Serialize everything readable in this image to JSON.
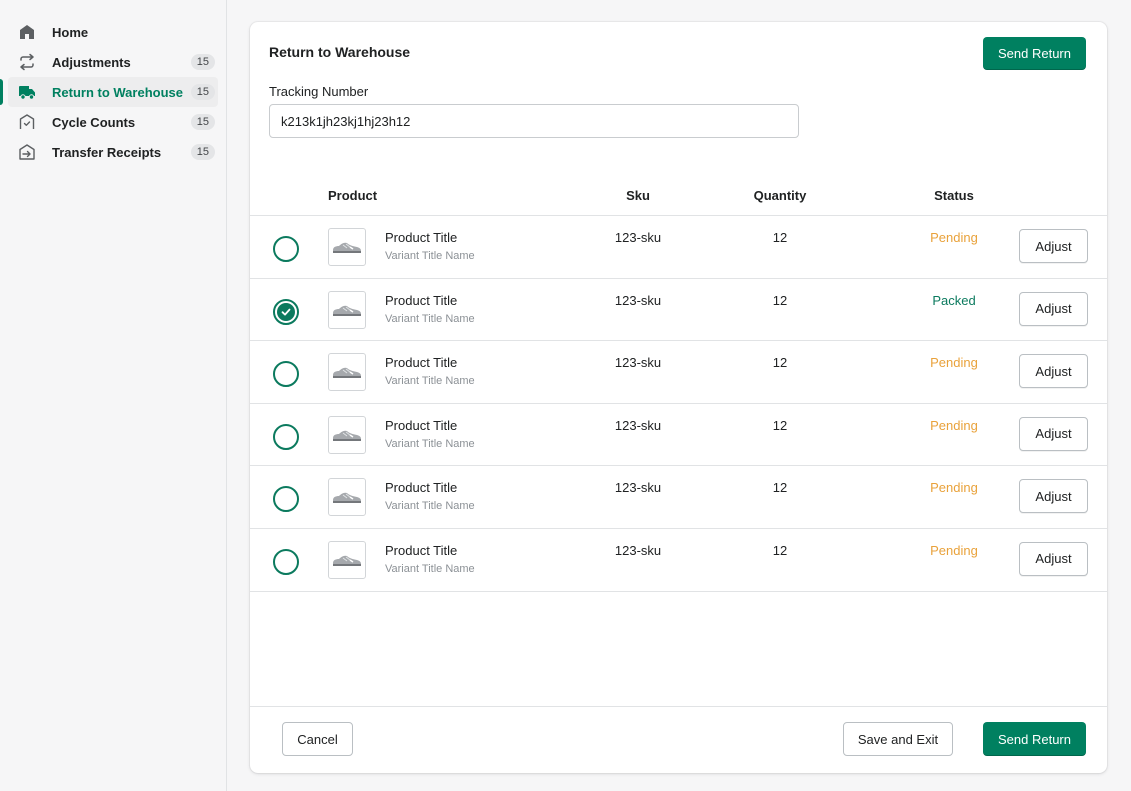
{
  "sidebar": {
    "items": [
      {
        "label": "Home",
        "icon": "home-icon",
        "badge": null,
        "active": false
      },
      {
        "label": "Adjustments",
        "icon": "arrows-exchange-icon",
        "badge": "15",
        "active": false
      },
      {
        "label": "Return to Warehouse",
        "icon": "truck-icon",
        "badge": "15",
        "active": true
      },
      {
        "label": "Cycle Counts",
        "icon": "warehouse-check-icon",
        "badge": "15",
        "active": false
      },
      {
        "label": "Transfer Receipts",
        "icon": "warehouse-arrow-icon",
        "badge": "15",
        "active": false
      }
    ]
  },
  "page": {
    "title": "Return to Warehouse",
    "send_return_label": "Send Return",
    "tracking": {
      "label": "Tracking Number",
      "value": "k213k1jh23kj1hj23h12"
    }
  },
  "table": {
    "columns": {
      "product": "Product",
      "sku": "Sku",
      "quantity": "Quantity",
      "status": "Status"
    },
    "adjust_label": "Adjust",
    "rows": [
      {
        "selected": false,
        "title": "Product Title",
        "variant": "Variant Title Name",
        "sku": "123-sku",
        "quantity": "12",
        "status": "Pending"
      },
      {
        "selected": true,
        "title": "Product Title",
        "variant": "Variant Title Name",
        "sku": "123-sku",
        "quantity": "12",
        "status": "Packed"
      },
      {
        "selected": false,
        "title": "Product Title",
        "variant": "Variant Title Name",
        "sku": "123-sku",
        "quantity": "12",
        "status": "Pending"
      },
      {
        "selected": false,
        "title": "Product Title",
        "variant": "Variant Title Name",
        "sku": "123-sku",
        "quantity": "12",
        "status": "Pending"
      },
      {
        "selected": false,
        "title": "Product Title",
        "variant": "Variant Title Name",
        "sku": "123-sku",
        "quantity": "12",
        "status": "Pending"
      },
      {
        "selected": false,
        "title": "Product Title",
        "variant": "Variant Title Name",
        "sku": "123-sku",
        "quantity": "12",
        "status": "Pending"
      }
    ]
  },
  "footer": {
    "cancel_label": "Cancel",
    "save_exit_label": "Save and Exit",
    "send_return_label": "Send Return"
  },
  "colors": {
    "accent": "#008060",
    "pending": "#e9a23b",
    "packed": "#0b7a5e"
  }
}
